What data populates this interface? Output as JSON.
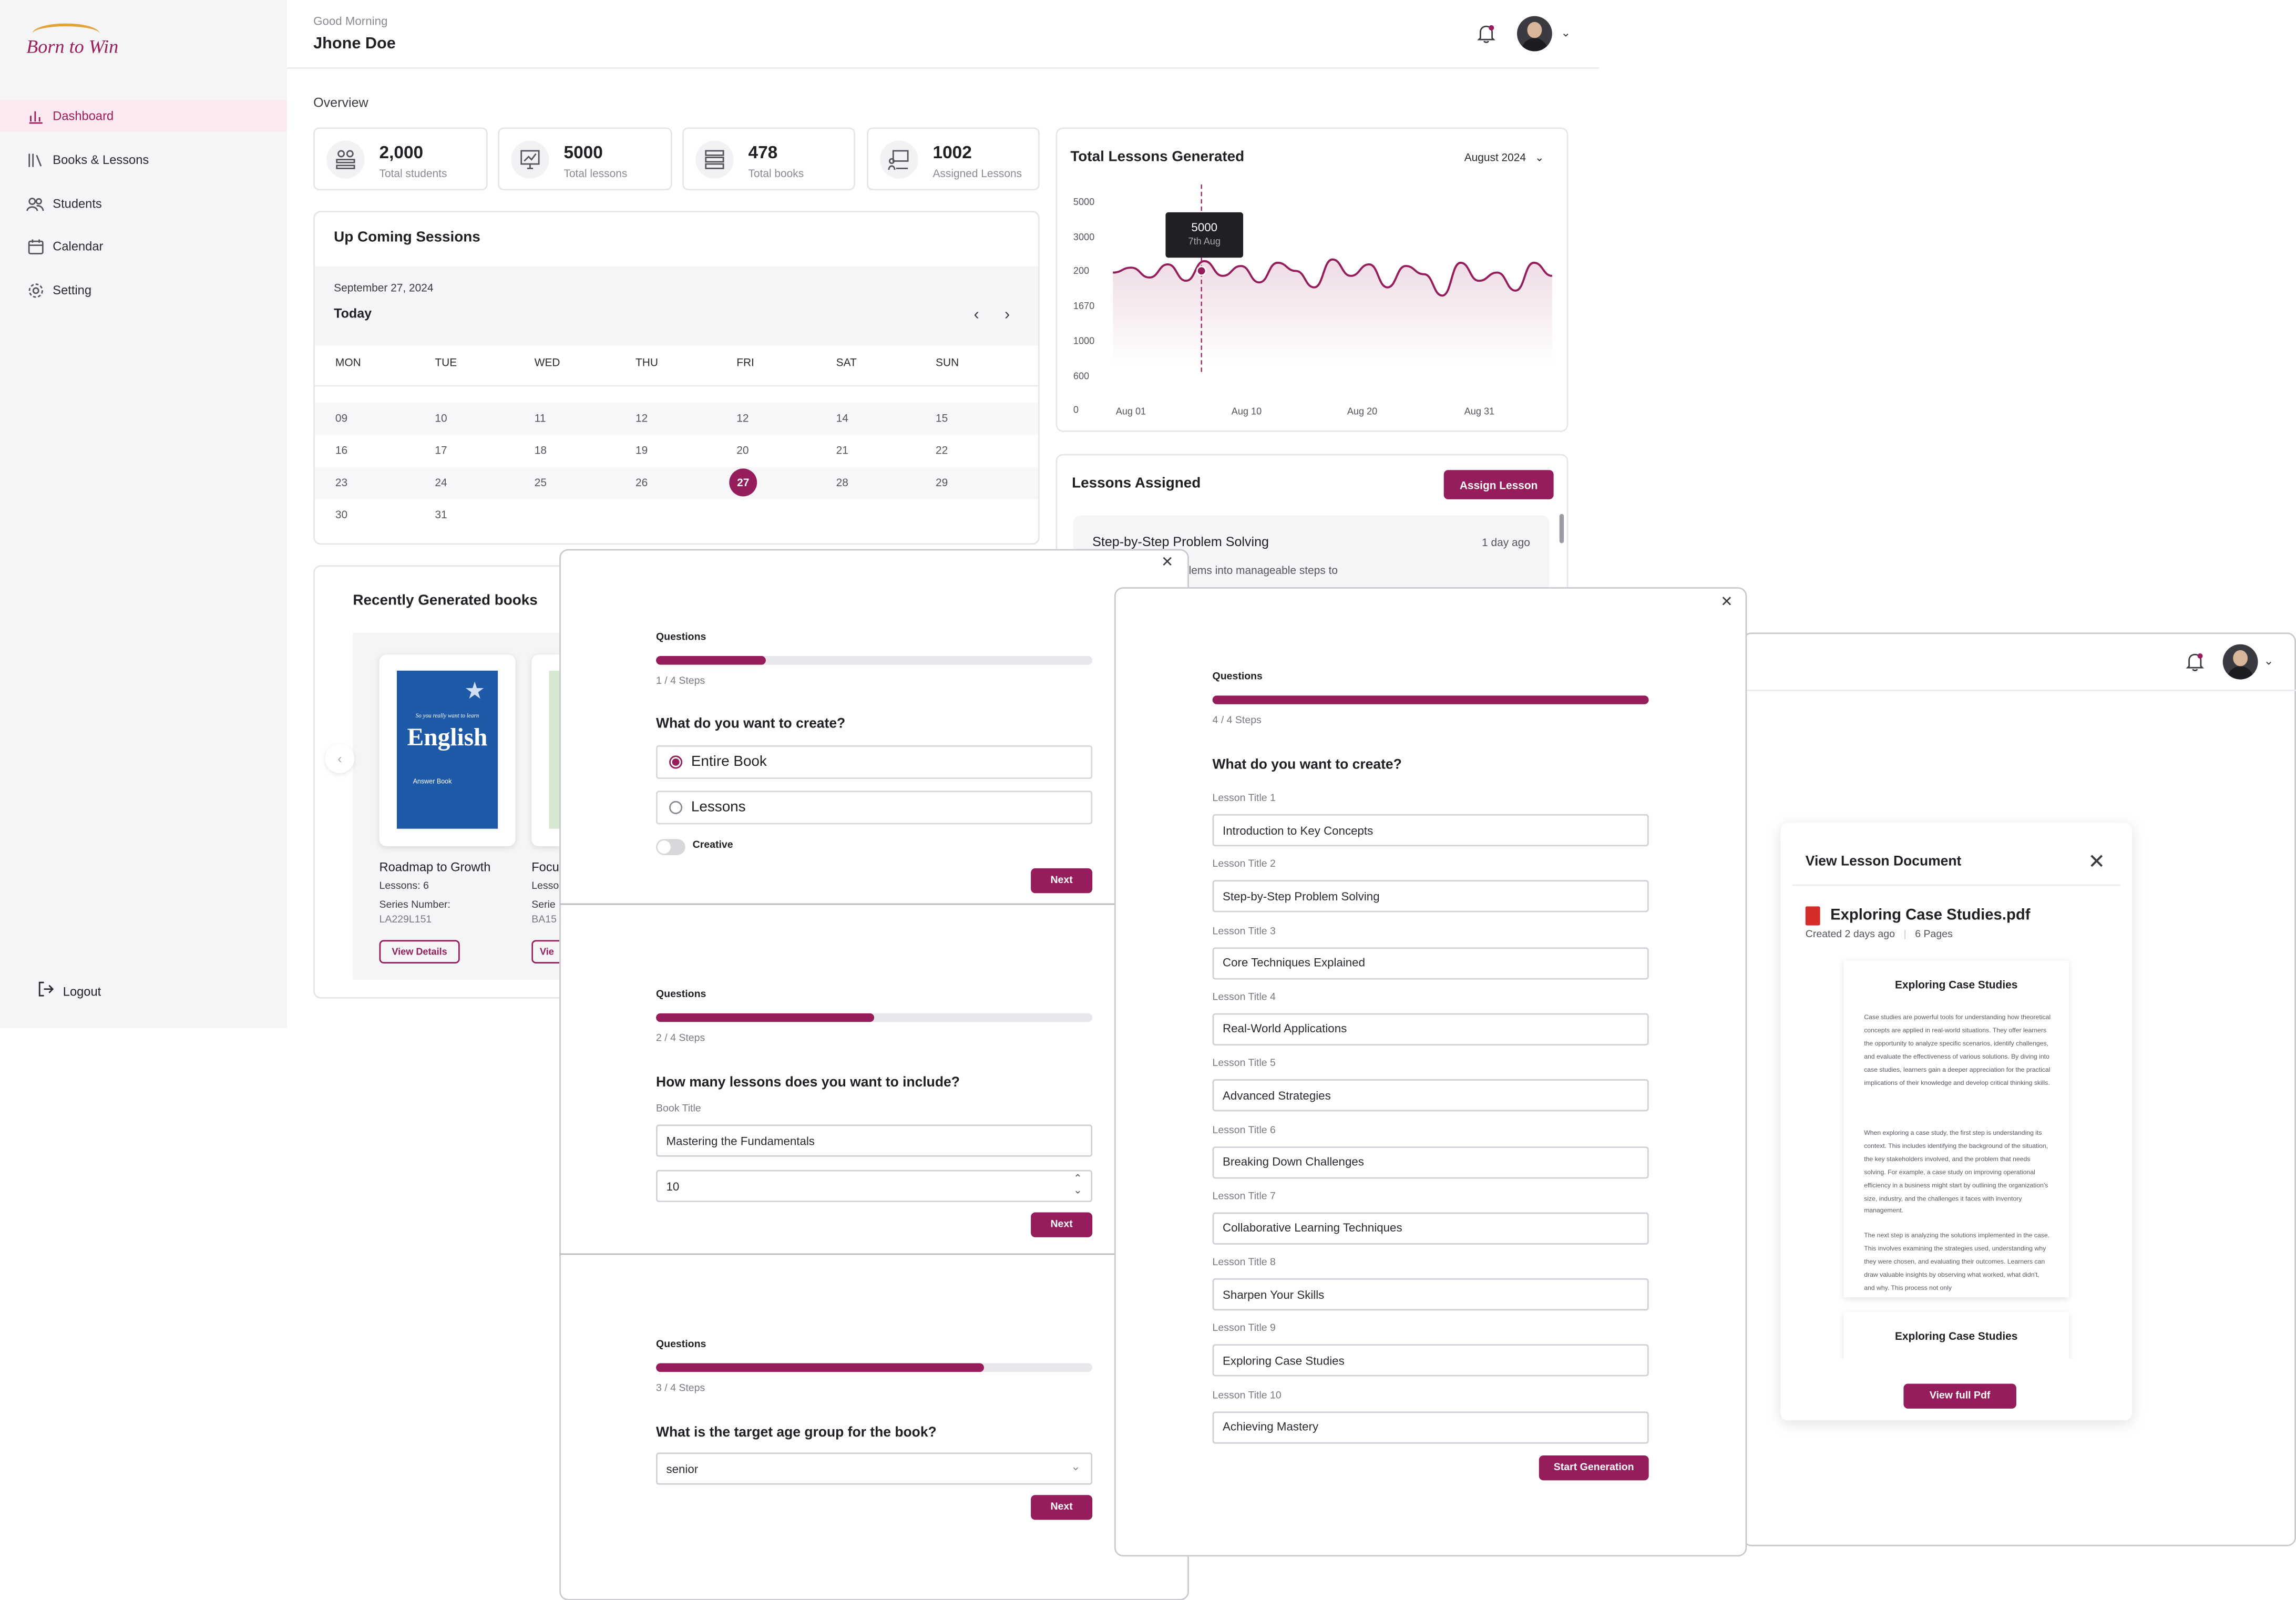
{
  "brand": {
    "logo_text": "Born to Win",
    "accent": "#951d5b"
  },
  "sidebar": {
    "items": [
      {
        "label": "Dashboard",
        "icon": "bar-chart-icon",
        "active": true
      },
      {
        "label": "Books & Lessons",
        "icon": "books-icon",
        "active": false
      },
      {
        "label": "Students",
        "icon": "users-icon",
        "active": false
      },
      {
        "label": "Calendar",
        "icon": "calendar-icon",
        "active": false
      },
      {
        "label": "Setting",
        "icon": "gear-icon",
        "active": false
      }
    ],
    "logout": "Logout"
  },
  "header": {
    "greeting": "Good Morning",
    "user_name": "Jhone Doe"
  },
  "overview": {
    "title": "Overview",
    "stats": [
      {
        "value": "2,000",
        "label": "Total students",
        "icon": "students-icon"
      },
      {
        "value": "5000",
        "label": "Total lessons",
        "icon": "monitor-icon"
      },
      {
        "value": "478",
        "label": "Total books",
        "icon": "books-stack-icon"
      },
      {
        "value": "1002",
        "label": "Assigned Lessons",
        "icon": "presentation-icon"
      }
    ]
  },
  "sessions": {
    "title": "Up Coming Sessions",
    "date": "September 27, 2024",
    "today": "Today",
    "days": [
      "MON",
      "TUE",
      "WED",
      "THU",
      "FRI",
      "SAT",
      "SUN"
    ],
    "weeks": [
      [
        "09",
        "10",
        "11",
        "12",
        "12",
        "14",
        "15"
      ],
      [
        "16",
        "17",
        "18",
        "19",
        "20",
        "21",
        "22"
      ],
      [
        "23",
        "24",
        "25",
        "26",
        "27",
        "28",
        "29"
      ],
      [
        "30",
        "31"
      ]
    ],
    "selected": "27"
  },
  "books": {
    "title": "Recently Generated books",
    "items": [
      {
        "name": "Roadmap to Growth",
        "lessons": "Lessons: 6",
        "series_label": "Series Number:",
        "series": "LA229L151",
        "button": "View Details",
        "cover_title": "English",
        "cover_tagline": "So you really want to learn",
        "cover_sub": "Answer Book"
      },
      {
        "name": "Focu",
        "lessons": "Lesso",
        "series_label": "Serie",
        "series": "BA15",
        "button": "Vie"
      }
    ]
  },
  "chart_data": {
    "type": "line",
    "title": "Total Lessons Generated",
    "period": "August 2024",
    "y_ticks": [
      "5000",
      "3000",
      "200",
      "1670",
      "1000",
      "600",
      "0"
    ],
    "x_ticks": [
      "Aug 01",
      "Aug 10",
      "Aug 20",
      "Aug 31"
    ],
    "tooltip": {
      "value": "5000",
      "label": "7th Aug"
    },
    "series": [
      {
        "color": "#951d5b",
        "values": [
          0.57,
          0.6,
          0.54,
          0.62,
          0.52,
          0.64,
          0.55,
          0.61,
          0.51,
          0.63,
          0.58,
          0.48,
          0.65,
          0.55,
          0.62,
          0.48,
          0.61,
          0.56,
          0.43,
          0.63,
          0.52,
          0.57,
          0.46,
          0.63,
          0.55
        ]
      }
    ],
    "grid": false
  },
  "assigned": {
    "title": "Lessons Assigned",
    "button": "Assign Lesson",
    "item_title": "Step-by-Step Problem Solving",
    "item_time": "1 day ago",
    "item_desc": "breaking down problems into manageable steps to"
  },
  "modal1": {
    "questions": "Questions",
    "progress": 0.25,
    "steps": "1 / 4 Steps",
    "question": "What do you want to create?",
    "options": [
      "Entire Book",
      "Lessons"
    ],
    "toggle_label": "Creative",
    "next": "Next"
  },
  "modal2": {
    "questions": "Questions",
    "progress": 0.5,
    "steps": "2 / 4 Steps",
    "question": "How many lessons does you want to include?",
    "book_title_label": "Book Title",
    "book_title": "Mastering the Fundamentals",
    "count": "10",
    "next": "Next"
  },
  "modal3": {
    "questions": "Questions",
    "progress": 0.75,
    "steps": "3 / 4 Steps",
    "question": "What is the target age group for the book?",
    "select_value": "senior",
    "next": "Next"
  },
  "modal4": {
    "questions": "Questions",
    "progress": 1.0,
    "steps": "4 / 4 Steps",
    "question": "What do you want to create?",
    "lessons": [
      {
        "label": "Lesson Title 1",
        "value": "Introduction to Key Concepts"
      },
      {
        "label": "Lesson Title 2",
        "value": "Step-by-Step Problem Solving"
      },
      {
        "label": "Lesson Title 3",
        "value": "Core Techniques Explained"
      },
      {
        "label": "Lesson Title 4",
        "value": "Real-World Applications"
      },
      {
        "label": "Lesson Title 5",
        "value": "Advanced Strategies"
      },
      {
        "label": "Lesson Title 6",
        "value": "Breaking Down Challenges"
      },
      {
        "label": "Lesson Title 7",
        "value": "Collaborative Learning Techniques"
      },
      {
        "label": "Lesson Title 8",
        "value": "Sharpen Your Skills"
      },
      {
        "label": "Lesson Title 9",
        "value": "Exploring Case Studies"
      },
      {
        "label": "Lesson Title 10",
        "value": "Achieving Mastery"
      }
    ],
    "start": "Start Generation"
  },
  "doc_panel": {
    "title": "View Lesson Document",
    "file_name": "Exploring Case Studies.pdf",
    "created": "Created 2 days ago",
    "pages": "6 Pages",
    "page_title": "Exploring Case Studies",
    "paragraphs": [
      "Case studies are powerful tools for understanding how theoretical concepts are applied in real-world situations. They offer learners the opportunity to analyze specific scenarios, identify challenges, and evaluate the effectiveness of various solutions. By diving into case studies, learners gain a deeper appreciation for the practical implications of their knowledge and develop critical thinking skills.",
      "When exploring a case study, the first step is understanding its context. This includes identifying the background of the situation, the key stakeholders involved, and the problem that needs solving. For example, a case study on improving operational efficiency in a business might start by outlining the organization's size, industry, and the challenges it faces with inventory management.",
      "The next step is analyzing the solutions implemented in the case. This involves examining the strategies used, understanding why they were chosen, and evaluating their outcomes. Learners can draw valuable insights by observing what worked, what didn't, and why. This process not only"
    ],
    "page2_title": "Exploring Case Studies",
    "button": "View full Pdf"
  }
}
